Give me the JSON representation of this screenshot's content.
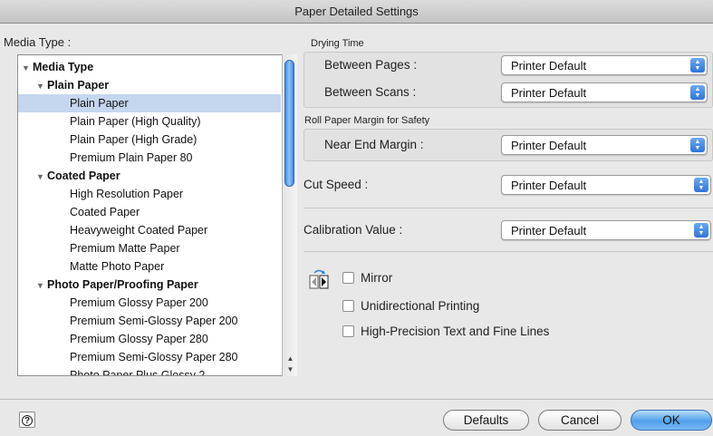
{
  "window": {
    "title": "Paper Detailed Settings"
  },
  "media_type": {
    "label": "Media Type :",
    "tree": [
      {
        "label": "Media Type",
        "level": 0,
        "bold": true,
        "expanded": true
      },
      {
        "label": "Plain Paper",
        "level": 1,
        "bold": true,
        "expanded": true
      },
      {
        "label": "Plain Paper",
        "level": 2,
        "selected": true
      },
      {
        "label": "Plain Paper (High Quality)",
        "level": 2
      },
      {
        "label": "Plain Paper (High Grade)",
        "level": 2
      },
      {
        "label": "Premium Plain Paper 80",
        "level": 2
      },
      {
        "label": "Coated Paper",
        "level": 1,
        "bold": true,
        "expanded": true
      },
      {
        "label": "High Resolution Paper",
        "level": 2
      },
      {
        "label": "Coated Paper",
        "level": 2
      },
      {
        "label": "Heavyweight Coated Paper",
        "level": 2
      },
      {
        "label": "Premium Matte Paper",
        "level": 2
      },
      {
        "label": "Matte Photo Paper",
        "level": 2
      },
      {
        "label": "Photo Paper/Proofing Paper",
        "level": 1,
        "bold": true,
        "expanded": true
      },
      {
        "label": "Premium Glossy Paper 200",
        "level": 2
      },
      {
        "label": "Premium Semi-Glossy Paper 200",
        "level": 2
      },
      {
        "label": "Premium Glossy Paper 280",
        "level": 2
      },
      {
        "label": "Premium Semi-Glossy Paper 280",
        "level": 2
      },
      {
        "label": "Photo Paper Plus Glossy 2",
        "level": 2
      }
    ]
  },
  "drying_time": {
    "title": "Drying Time",
    "between_pages": {
      "label": "Between Pages :",
      "value": "Printer Default"
    },
    "between_scans": {
      "label": "Between Scans :",
      "value": "Printer Default"
    }
  },
  "roll_margin": {
    "title": "Roll Paper Margin for Safety",
    "near_end": {
      "label": "Near End Margin :",
      "value": "Printer Default"
    }
  },
  "cut_speed": {
    "label": "Cut Speed :",
    "value": "Printer Default"
  },
  "calibration": {
    "label": "Calibration Value :",
    "value": "Printer Default"
  },
  "options": {
    "mirror": {
      "label": "Mirror",
      "checked": false
    },
    "unidirectional": {
      "label": "Unidirectional Printing",
      "checked": false
    },
    "high_precision": {
      "label": "High-Precision Text and Fine Lines",
      "checked": false
    }
  },
  "footer": {
    "help_glyph": "?",
    "defaults_label": "Defaults",
    "cancel_label": "Cancel",
    "ok_label": "OK"
  },
  "colors": {
    "accent": "#4fa0ec",
    "selection": "#c5d7ef"
  }
}
